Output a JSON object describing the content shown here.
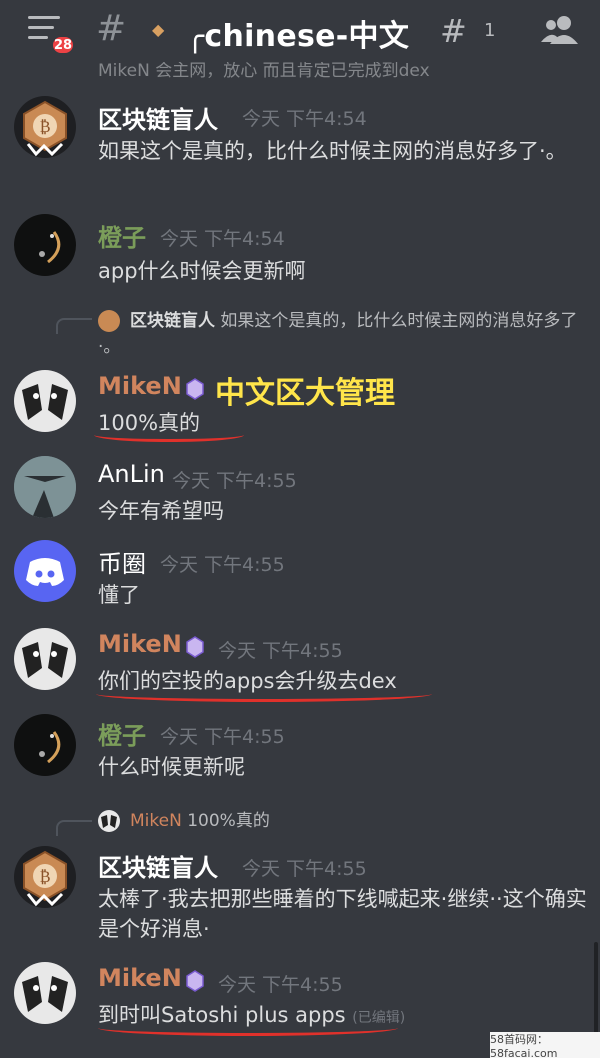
{
  "header": {
    "unread_badge": "28",
    "channel_name": "╭chinese-中文",
    "thread_count": "1"
  },
  "top_cut": {
    "text": "MikeN 会主网，放心 而且肯定已完成到dex"
  },
  "messages": [
    {
      "user": "区块链盲人",
      "time": "今天 下午4:54",
      "text": "如果这个是真的，比什么时候主网的消息好多了·。"
    },
    {
      "user": "橙子",
      "time": "今天 下午4:54",
      "text": "app什么时候会更新啊"
    },
    {
      "reply_user": "区块链盲人",
      "reply_text": "如果这个是真的，比什么时候主网的消息好多了·。",
      "user": "MikeN",
      "annotation": "中文区大管理",
      "text": "100%真的"
    },
    {
      "user": "AnLin",
      "time": "今天 下午4:55",
      "text": "今年有希望吗"
    },
    {
      "user": "币圈",
      "time": "今天 下午4:55",
      "text": "懂了"
    },
    {
      "user": "MikeN",
      "time": "今天 下午4:55",
      "text": "你们的空投的apps会升级去dex"
    },
    {
      "user": "橙子",
      "time": "今天 下午4:55",
      "text": "什么时候更新呢"
    },
    {
      "reply_user": "MikeN",
      "reply_text": "100%真的",
      "user": "区块链盲人",
      "time": "今天 下午4:55",
      "text": "太棒了·我去把那些睡着的下线喊起来·继续··这个确实是个好消息·"
    },
    {
      "user": "MikeN",
      "time": "今天 下午4:55",
      "text": "到时叫Satoshi plus apps",
      "edited": "(已编辑)"
    }
  ],
  "watermark": "58首码网：58facai.com",
  "colors": {
    "background": "#36393f",
    "name_green": "#7b9d5a",
    "name_orange": "#d1855e",
    "annotation": "#ffe54a",
    "underline": "#e0312b",
    "discord_blurple": "#5865f2"
  }
}
